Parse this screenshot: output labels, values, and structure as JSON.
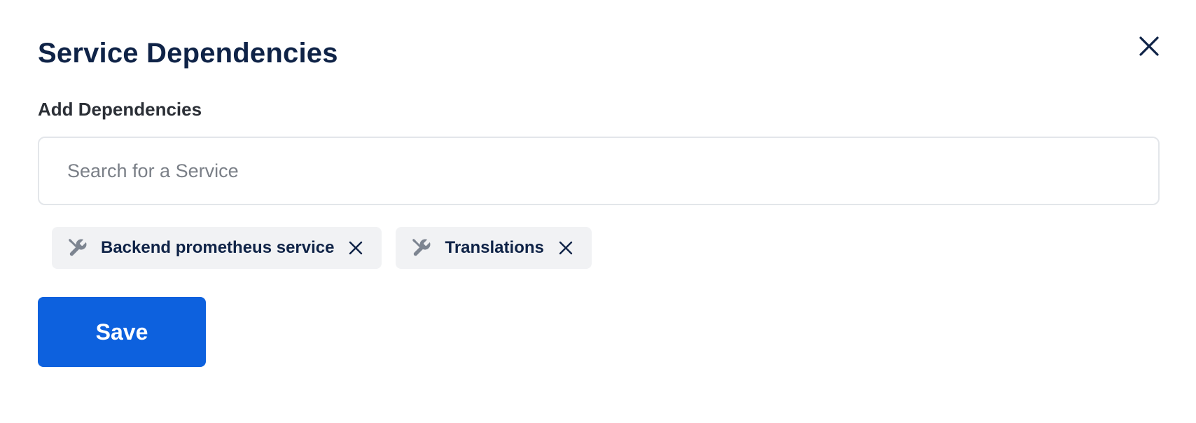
{
  "dialog": {
    "title": "Service Dependencies",
    "close_icon": "close-icon"
  },
  "form": {
    "label": "Add Dependencies",
    "search": {
      "placeholder": "Search for a Service",
      "value": "",
      "icon": "search-icon"
    },
    "selected": [
      {
        "label": "Backend prometheus service",
        "icon": "tools-icon",
        "remove_icon": "close-icon"
      },
      {
        "label": "Translations",
        "icon": "tools-icon",
        "remove_icon": "close-icon"
      }
    ],
    "save_label": "Save"
  },
  "colors": {
    "title": "#0f2347",
    "accent": "#0d61de",
    "chip_bg": "#f1f2f4",
    "chip_icon": "#7d8591",
    "border": "#e3e6ea"
  }
}
